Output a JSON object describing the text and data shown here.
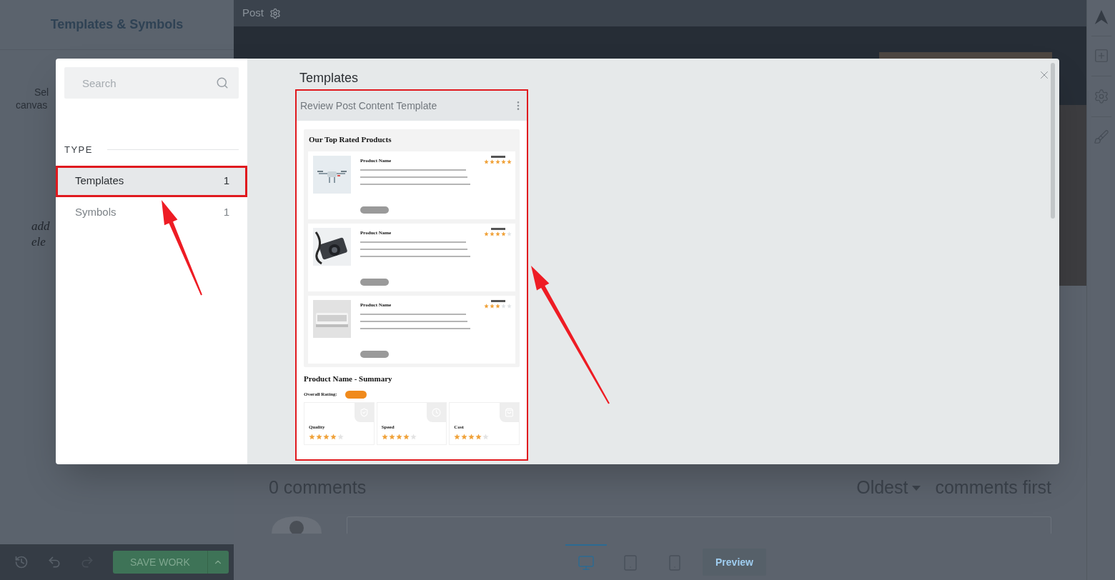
{
  "editor": {
    "sidebar_title": "Templates & Symbols",
    "sidebar_fragments": [
      "Sel",
      "canvas"
    ],
    "handwritten_fragments": [
      "add",
      "ele"
    ],
    "top_bar": {
      "label": "Post"
    },
    "save_button": "SAVE WORK",
    "comments": {
      "count": "0 comments",
      "sort": "Oldest",
      "sort_suffix": "comments first"
    },
    "devices": [
      {
        "kind": "desktop",
        "selected": true
      },
      {
        "kind": "tablet",
        "selected": false
      },
      {
        "kind": "mobile",
        "selected": false
      }
    ],
    "preview_button": "Preview"
  },
  "modal": {
    "search": {
      "placeholder": "Search"
    },
    "type_heading": "TYPE",
    "types": [
      {
        "label": "Templates",
        "count": "1",
        "selected": true,
        "highlighted": true
      },
      {
        "label": "Symbols",
        "count": "1",
        "selected": false,
        "highlighted": false
      }
    ],
    "section_title": "Templates",
    "templates": [
      {
        "title": "Review Post Content Template",
        "highlighted": true,
        "preview": {
          "heading": "Our Top Rated Products",
          "products": [
            {
              "name": "Product Name",
              "stars": 5
            },
            {
              "name": "Product Name",
              "stars": 4
            },
            {
              "name": "Product Name",
              "stars": 3
            }
          ],
          "summary": {
            "title": "Product Name - Summary",
            "rating_label": "Overall Rating:",
            "criteria": [
              {
                "label": "Quality",
                "stars": 4
              },
              {
                "label": "Speed",
                "stars": 4
              },
              {
                "label": "Cost",
                "stars": 4
              }
            ]
          }
        }
      }
    ]
  }
}
